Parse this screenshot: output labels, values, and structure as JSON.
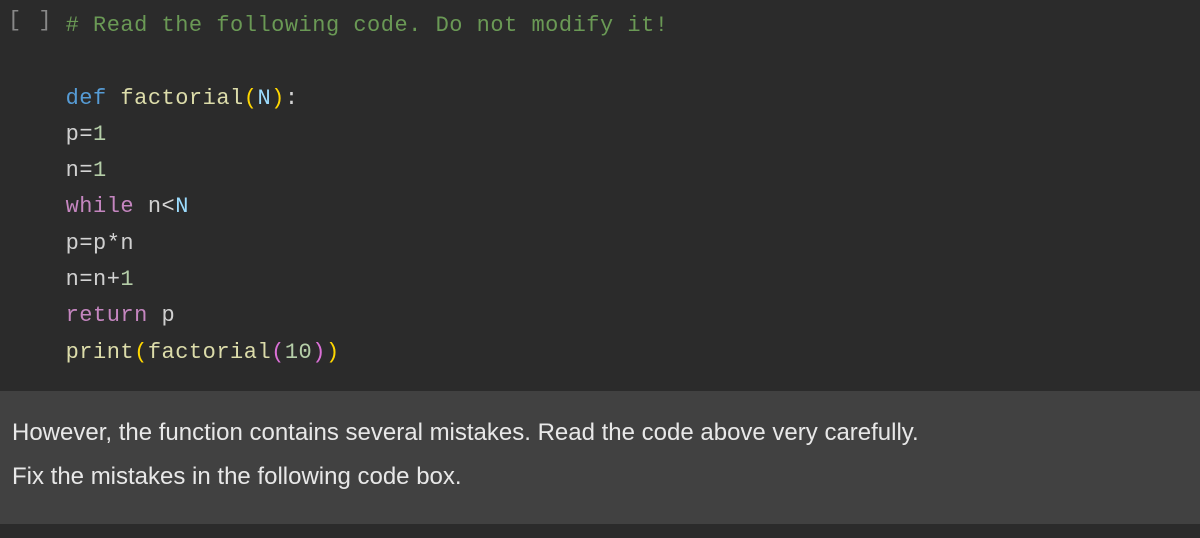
{
  "cell": {
    "prompt": "[ ]",
    "code": {
      "line1_comment": "# Read the following code. Do not modify it!",
      "line2": "",
      "line3_def": "def",
      "line3_funcname": "factorial",
      "line3_open": "(",
      "line3_param": "N",
      "line3_close": ")",
      "line3_colon": ":",
      "line4_var": "p",
      "line4_eq": "=",
      "line4_val": "1",
      "line5_var": "n",
      "line5_eq": "=",
      "line5_val": "1",
      "line6_while": "while",
      "line6_var": "n",
      "line6_lt": "<",
      "line6_param": "N",
      "line7_lhs": "p",
      "line7_eq": "=",
      "line7_a": "p",
      "line7_op": "*",
      "line7_b": "n",
      "line8_lhs": "n",
      "line8_eq": "=",
      "line8_a": "n",
      "line8_op": "+",
      "line8_b": "1",
      "line9_return": "return",
      "line9_var": "p",
      "line10_print": "print",
      "line10_open": "(",
      "line10_call": "factorial",
      "line10_inner_open": "(",
      "line10_arg": "10",
      "line10_inner_close": ")",
      "line10_close": ")"
    }
  },
  "instruction": {
    "line1": "However, the function contains several mistakes. Read the code above very carefully.",
    "line2": "Fix the mistakes in the following code box."
  }
}
